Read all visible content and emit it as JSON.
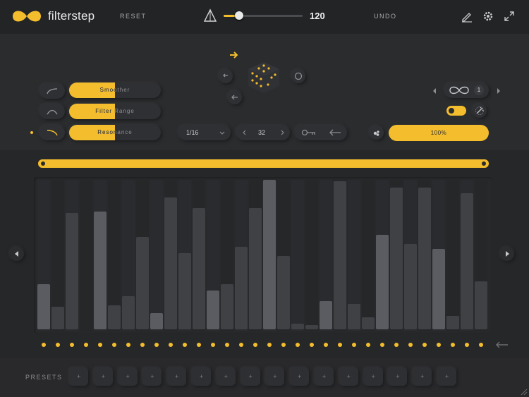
{
  "colors": {
    "accent": "#f3bd2d",
    "bar_light": "#5a5c61",
    "bar_dark": "#3f4145"
  },
  "header": {
    "app_title": "filterstep",
    "reset_label": "RESET",
    "undo_label": "UNDO",
    "tempo_value": "120",
    "tempo_slider_fraction": 0.2
  },
  "params": [
    {
      "label": "Smoother",
      "fill_fraction": 0.5
    },
    {
      "label": "Filter Range",
      "fill_fraction": 0.5
    },
    {
      "label": "Resonance",
      "fill_fraction": 0.5
    }
  ],
  "controls": {
    "rate": "1/16",
    "steps": "32",
    "loop_count": "1",
    "amount": "100%"
  },
  "steps": {
    "values": [
      0.3,
      0.15,
      0.78,
      0,
      0.79,
      0.16,
      0.22,
      0.62,
      0.11,
      0.88,
      0.51,
      0.81,
      0.26,
      0.3,
      0.55,
      0.81,
      1.0,
      0.49,
      0.04,
      0.03,
      0.19,
      0.99,
      0.17,
      0.08,
      0.63,
      0.95,
      0.57,
      0.95,
      0.54,
      0.09,
      0.91,
      0.32
    ],
    "light": [
      1,
      0,
      0,
      0,
      1,
      0,
      0,
      0,
      1,
      0,
      0,
      0,
      1,
      0,
      0,
      0,
      1,
      0,
      0,
      0,
      1,
      0,
      0,
      0,
      1,
      0,
      0,
      0,
      1,
      0,
      0,
      0
    ],
    "count": 32
  },
  "presets": {
    "label": "PRESETS",
    "slots": [
      "+",
      "+",
      "+",
      "+",
      "+",
      "+",
      "+",
      "+",
      "+",
      "+",
      "+",
      "+",
      "+",
      "+",
      "+",
      "+"
    ]
  }
}
